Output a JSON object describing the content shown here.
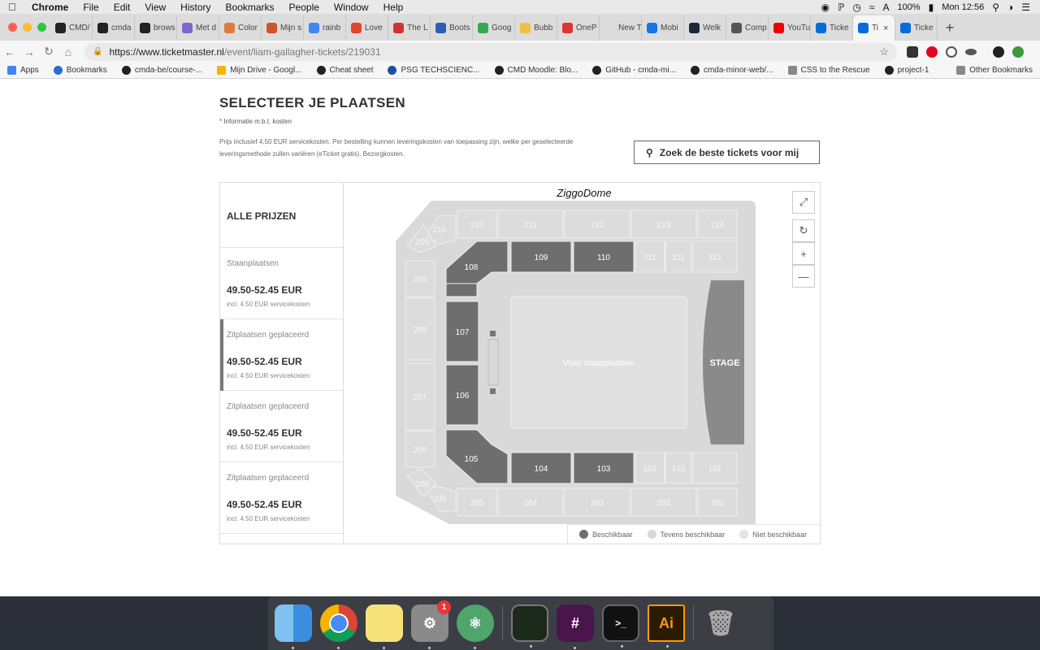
{
  "menubar": {
    "app": "Chrome",
    "items": [
      "File",
      "Edit",
      "View",
      "History",
      "Bookmarks",
      "People",
      "Window",
      "Help"
    ],
    "battery": "100%",
    "clock": "Mon 12:56"
  },
  "tabs": [
    {
      "label": "CMD/",
      "color": "#222"
    },
    {
      "label": "cmda",
      "color": "#222"
    },
    {
      "label": "brows",
      "color": "#222"
    },
    {
      "label": "Met d",
      "color": "#7b68c9"
    },
    {
      "label": "Color",
      "color": "#e07a3a"
    },
    {
      "label": "Mijn s",
      "color": "#d0532b"
    },
    {
      "label": "rainb",
      "color": "#4285f4"
    },
    {
      "label": "Love",
      "color": "#e0442b"
    },
    {
      "label": "The L",
      "color": "#c33"
    },
    {
      "label": "Boots",
      "color": "#2b5eb8"
    },
    {
      "label": "Goog",
      "color": "#34a853"
    },
    {
      "label": "Bubb",
      "color": "#f0c040"
    },
    {
      "label": "OneP",
      "color": "#d33"
    },
    {
      "label": "New Tab",
      "color": "#dcdcdc"
    },
    {
      "label": "Mobi",
      "color": "#1a73e8"
    },
    {
      "label": "Welk",
      "color": "#1b2838"
    },
    {
      "label": "Comp",
      "color": "#555"
    },
    {
      "label": "YouTu",
      "color": "#e00"
    },
    {
      "label": "Ticke",
      "color": "#026cdf"
    },
    {
      "label": "Ti",
      "color": "#026cdf",
      "active": true
    },
    {
      "label": "Ticke",
      "color": "#026cdf"
    }
  ],
  "address": {
    "host": "https://www.ticketmaster.nl",
    "path": "/event/liam-gallagher-tickets/219031"
  },
  "bookmarks": [
    "Apps",
    "Bookmarks",
    "cmda-be/course-...",
    "Mijn Drive - Googl...",
    "Cheat sheet",
    "PSG TECHSCIENC...",
    "CMD Moodle: Blo...",
    "GitHub - cmda-mi...",
    "cmda-minor-web/...",
    "CSS to the Rescue",
    "project-1"
  ],
  "other_bookmarks": "Other Bookmarks",
  "page": {
    "title": "SELECTEER JE PLAATSEN",
    "note1": "* Informatie m.b.t. kosten",
    "note2": "Prijs inclusief 4.50 EUR servicekosten.  Per bestelling kunnen leveringskosten van toepassing zijn, welke per geselecteerde leveringsmethode zullen variëren (eTicket gratis). Bezorgkosten.",
    "search_button": "Zoek de beste tickets voor mij"
  },
  "sidebar": {
    "header": "ALLE PRIJZEN",
    "items": [
      {
        "category": "Staanplaatsen",
        "price": "49.50-52.45 EUR",
        "fee": "incl. 4.50 EUR servicekosten",
        "selected": false
      },
      {
        "category": "Zitplaatsen geplaceerd",
        "price": "49.50-52.45 EUR",
        "fee": "incl. 4.50 EUR servicekosten",
        "selected": true
      },
      {
        "category": "Zitplaatsen geplaceerd",
        "price": "49.50-52.45 EUR",
        "fee": "incl. 4.50 EUR servicekosten",
        "selected": false
      },
      {
        "category": "Zitplaatsen geplaceerd",
        "price": "49.50-52.45 EUR",
        "fee": "incl. 4.50 EUR servicekosten",
        "selected": false
      }
    ]
  },
  "map": {
    "venue": "ZiggoDome",
    "floor_label": "Vloer staanplaatsen",
    "stage_label": "STAGE",
    "colors": {
      "available": "#6e6e6e",
      "other": "#dcdcdc",
      "unavailable": "#e6e6e6"
    },
    "legend": [
      {
        "label": "Beschikbaar",
        "color": "#6e6e6e"
      },
      {
        "label": "Tevens beschikbaar",
        "color": "#d8d8d8"
      },
      {
        "label": "Niet beschikbaar",
        "color": "#e4e4e4"
      }
    ],
    "sections": {
      "available": [
        "109",
        "110",
        "108",
        "107",
        "106",
        "105",
        "104",
        "103"
      ],
      "upper_top": [
        "210",
        "211",
        "212",
        "213",
        "214"
      ],
      "upper_bottom": [
        "205",
        "204",
        "203",
        "202",
        "201"
      ],
      "upper_left": [
        "209",
        "208",
        "207",
        "206"
      ],
      "lower_right_top": [
        "111",
        "111",
        "112"
      ],
      "lower_right_bottom": [
        "102",
        "102",
        "101"
      ]
    }
  },
  "controls": {
    "fullscreen": "fullscreen-icon",
    "reset": "reset-icon",
    "zoom_in": "+",
    "zoom_out": "—"
  },
  "dock": {
    "badge_count": "1"
  }
}
